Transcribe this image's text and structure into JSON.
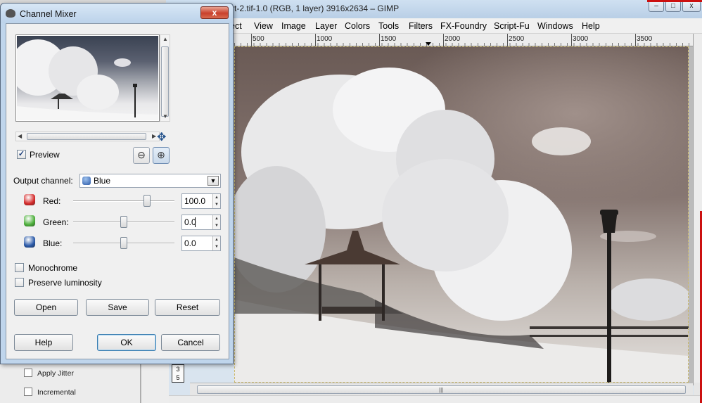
{
  "gimp": {
    "title": "rt-2.tif-1.0 (RGB, 1 layer) 3916x2634 – GIMP",
    "menu": [
      "ect",
      "View",
      "Image",
      "Layer",
      "Colors",
      "Tools",
      "Filters",
      "FX-Foundry",
      "Script-Fu",
      "Windows",
      "Help"
    ],
    "ruler_labels": [
      "500",
      "1000",
      "1500",
      "2000",
      "2500",
      "3000",
      "3500"
    ],
    "window_buttons": [
      "–",
      "□",
      "x"
    ],
    "tool_options": [
      "Apply Jitter",
      "Incremental"
    ],
    "layer_numbers": "3\n5"
  },
  "dialog": {
    "title": "Channel Mixer",
    "close_label": "x",
    "preview_label": "Preview",
    "preview_checked": true,
    "output_channel_label": "Output channel:",
    "output_channel_value": "Blue",
    "channels": [
      {
        "label": "Red:",
        "value": "100.0",
        "slider_fraction": 0.73,
        "color": "#d42a2a"
      },
      {
        "label": "Green:",
        "value": "0.0",
        "slider_fraction": 0.5,
        "color": "#4caf3a"
      },
      {
        "label": "Blue:",
        "value": "0.0",
        "slider_fraction": 0.5,
        "color": "#2a59a8"
      }
    ],
    "monochrome_label": "Monochrome",
    "preserve_luminosity_label": "Preserve luminosity",
    "buttons": {
      "open": "Open",
      "save": "Save",
      "reset": "Reset",
      "help": "Help",
      "ok": "OK",
      "cancel": "Cancel"
    }
  }
}
